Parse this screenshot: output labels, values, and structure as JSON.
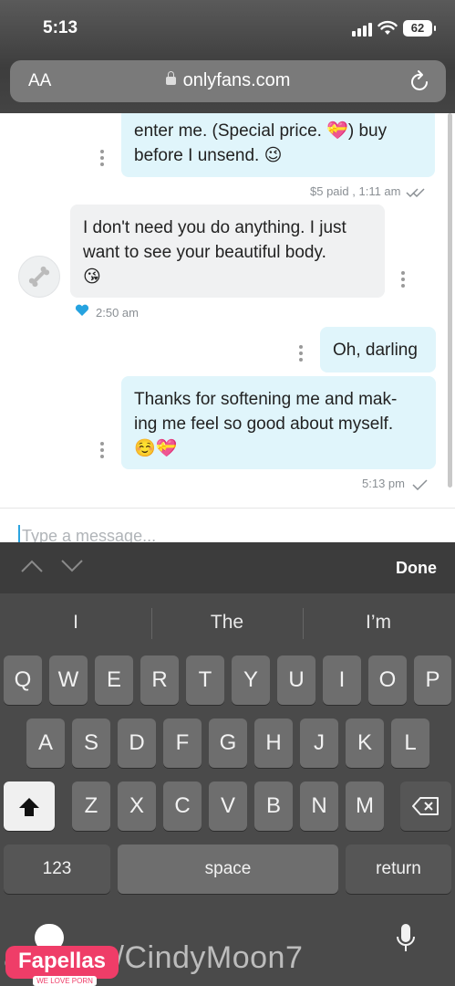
{
  "status": {
    "time": "5:13",
    "battery": "62"
  },
  "browser": {
    "aa_label": "AA",
    "url": "onlyfans.com"
  },
  "messages": [
    {
      "dir": "out",
      "text_lines": [
        "enter me. (Special price. 💝) buy",
        "before I unsend. 😉"
      ],
      "meta": "$5 paid , 1:11 am"
    },
    {
      "dir": "in",
      "text_lines": [
        "I don't need you do anything. I just",
        "want to see your beautiful body.",
        "😘"
      ],
      "meta": "2:50 am",
      "liked": true
    },
    {
      "dir": "out",
      "text_lines": [
        "Oh, darling"
      ]
    },
    {
      "dir": "out",
      "text_lines": [
        "Thanks for softening me and mak-",
        "ing me feel so good about myself.",
        "☺️💝"
      ],
      "meta": "5:13 pm"
    }
  ],
  "composer": {
    "placeholder": "Type a message..."
  },
  "accessory": {
    "done_label": "Done"
  },
  "keyboard": {
    "suggestions": [
      "I",
      "The",
      "I’m"
    ],
    "row1": [
      "Q",
      "W",
      "E",
      "R",
      "T",
      "Y",
      "U",
      "I",
      "O",
      "P"
    ],
    "row2": [
      "A",
      "S",
      "D",
      "F",
      "G",
      "H",
      "J",
      "K",
      "L"
    ],
    "row3": [
      "Z",
      "X",
      "C",
      "V",
      "B",
      "N",
      "M"
    ],
    "numbers_label": "123",
    "space_label": "space",
    "return_label": "return"
  },
  "watermark": {
    "text": "ans.c m/CindyMoon7",
    "logo": "Fapellas",
    "logo_tag": "WE LOVE PORN"
  }
}
